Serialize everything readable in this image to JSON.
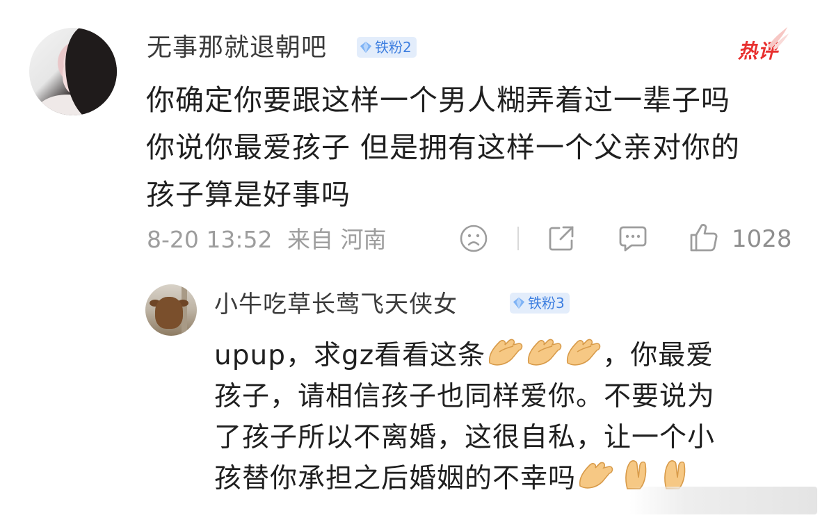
{
  "comment": {
    "username": "无事那就退朝吧",
    "badge": "铁粉2",
    "hot_label": "热评",
    "lines": [
      "你确定你要跟这样一个男人糊弄着过一辈子吗",
      "你说你最爱孩子 但是拥有这样一个父亲对你的",
      "孩子算是好事吗"
    ],
    "date": "8-20 13:52",
    "source": "来自 河南",
    "like_count": "1028",
    "icons": {
      "dislike": "sad-face-icon",
      "share": "share-icon",
      "reply": "comment-icon",
      "like": "thumbs-up-icon"
    }
  },
  "reply": {
    "username": "小牛吃草长莺飞天侠女",
    "badge": "铁粉3",
    "line1_prefix": "upup，求gz看看这条",
    "line1_suffix": "，你最爱",
    "line2": "孩子，请相信孩子也同样爱你。不要说为",
    "line3": "了孩子所以不离婚，这很自私，让一个小",
    "line4_prefix": "孩替你承担之后婚姻的不幸吗",
    "emoji": "folded-hands-emoji"
  },
  "colors": {
    "hot": "#e8302f",
    "badge_bg": "#e3edfb",
    "badge_text": "#3e7fe0",
    "meta_text": "#9d9d9d"
  }
}
